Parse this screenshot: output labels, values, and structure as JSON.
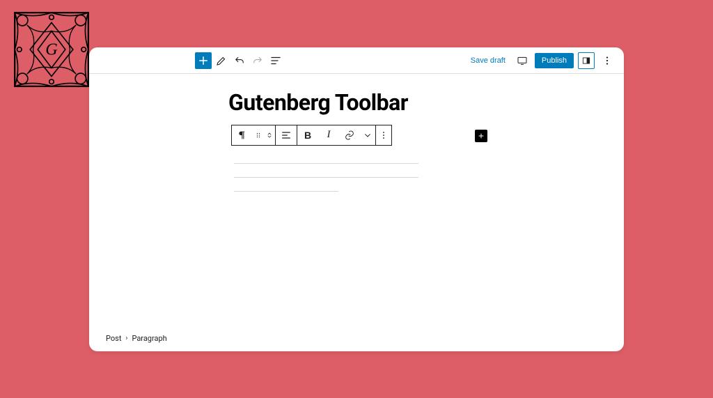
{
  "header": {
    "save_draft_label": "Save draft",
    "publish_label": "Publish"
  },
  "editor": {
    "post_title": "Gutenberg Toolbar"
  },
  "block_toolbar": {
    "bold_label": "B",
    "italic_label": "I"
  },
  "breadcrumb": {
    "root": "Post",
    "current": "Paragraph"
  },
  "colors": {
    "accent": "#007cba",
    "background": "#dd5e66"
  }
}
